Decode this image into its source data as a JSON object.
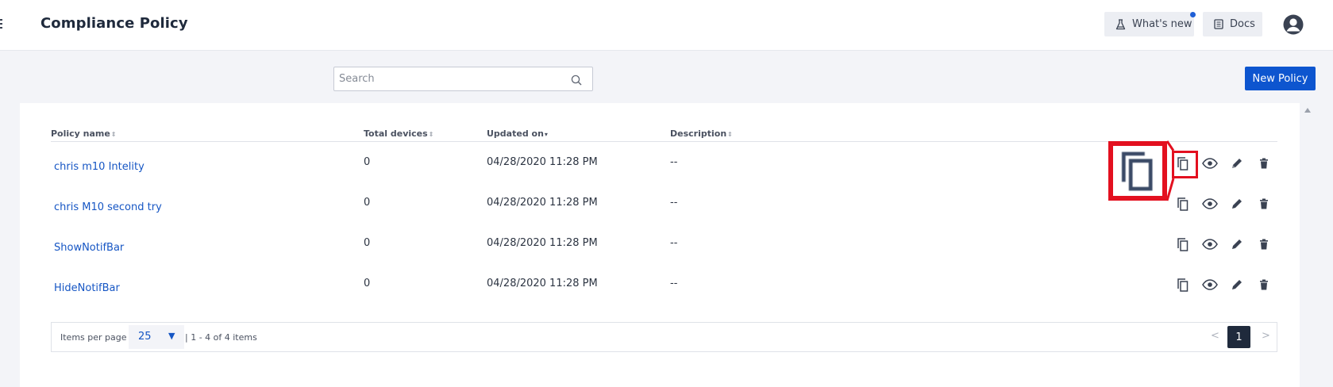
{
  "header": {
    "title": "Compliance Policy",
    "whats_new_label": "What's new",
    "docs_label": "Docs"
  },
  "toolbar": {
    "search_placeholder": "Search",
    "new_policy_label": "New Policy"
  },
  "table": {
    "columns": [
      "Policy name",
      "Total devices",
      "Updated on",
      "Description"
    ],
    "rows": [
      {
        "name": "chris m10 Intelity",
        "devices": "0",
        "updated": "04/28/2020 11:28 PM",
        "description": "--"
      },
      {
        "name": "chris M10 second try",
        "devices": "0",
        "updated": "04/28/2020 11:28 PM",
        "description": "--"
      },
      {
        "name": "ShowNotifBar",
        "devices": "0",
        "updated": "04/28/2020 11:28 PM",
        "description": "--"
      },
      {
        "name": "HideNotifBar",
        "devices": "0",
        "updated": "04/28/2020 11:28 PM",
        "description": "--"
      }
    ],
    "row_actions": [
      "copy-icon",
      "eye-icon",
      "pencil-icon",
      "trash-icon"
    ],
    "sorted_column": "Updated on",
    "sort_direction": "descending"
  },
  "pagination": {
    "items_per_page_label": "Items per page",
    "items_per_page_value": "25",
    "range_text": "| 1 - 4 of 4 items",
    "current_page": "1"
  },
  "highlight": {
    "target": "copy-icon",
    "row": 0,
    "color": "#e3101f"
  },
  "colors": {
    "primary": "#0d55cf",
    "link": "#1656c4",
    "dark": "#1f2a3c",
    "notification_dot": "#1f5fd6"
  }
}
